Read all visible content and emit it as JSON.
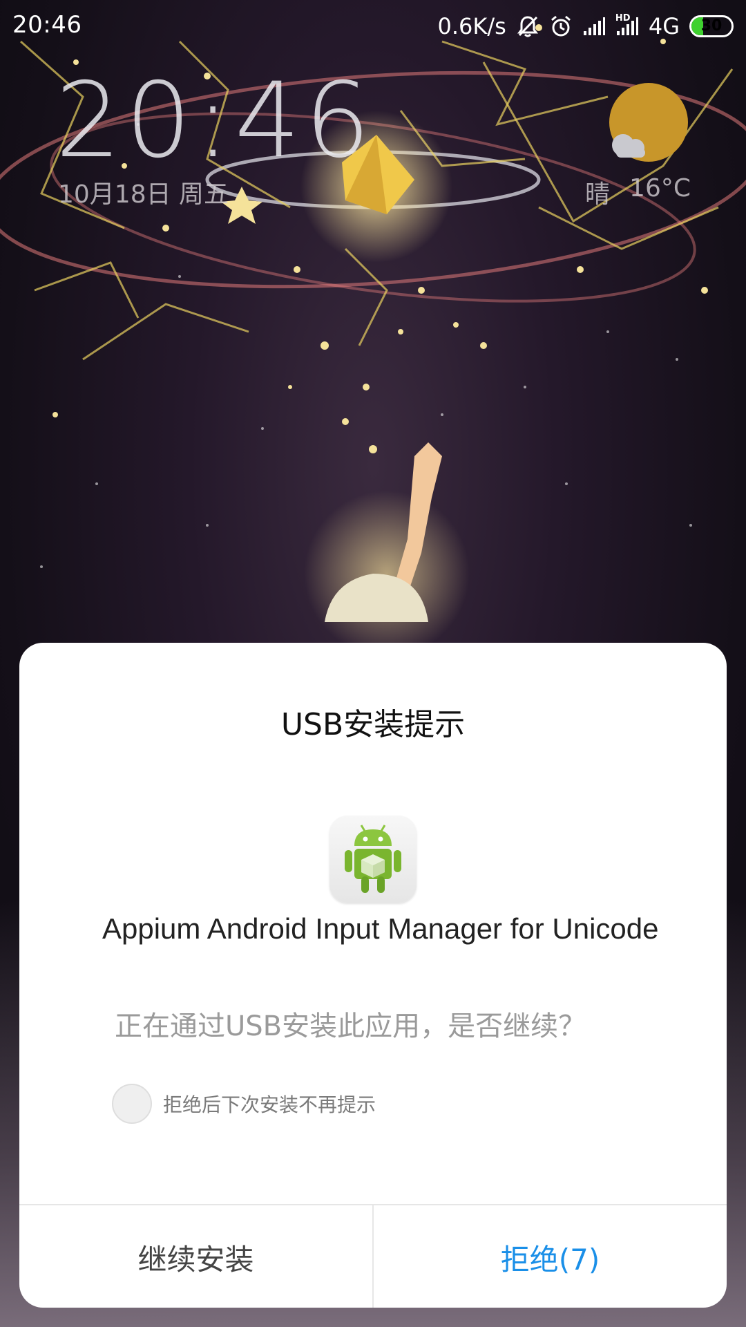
{
  "status_bar": {
    "time": "20:46",
    "net_speed": "0.6K/s",
    "network_type": "4G",
    "hd_label": "HD",
    "battery_level": "30",
    "battery_fraction": 0.3
  },
  "lock_screen": {
    "clock": "20:46",
    "date": "10月18日 周五",
    "weather": {
      "condition": "晴",
      "temperature": "16°C",
      "icon": "sun-cloud-icon"
    }
  },
  "dialog": {
    "title": "USB安装提示",
    "app_icon": "android-robot-icon",
    "app_name": "Appium Android Input Manager for Unicode",
    "message": "正在通过USB安装此应用，是否继续？",
    "checkbox_label": "拒绝后下次安装不再提示",
    "checkbox_checked": false,
    "buttons": {
      "continue": "继续安装",
      "reject": "拒绝(7)"
    }
  },
  "colors": {
    "accent_blue": "#1a8fe8",
    "battery_green": "#3fd12f",
    "dialog_bg": "#ffffff"
  }
}
